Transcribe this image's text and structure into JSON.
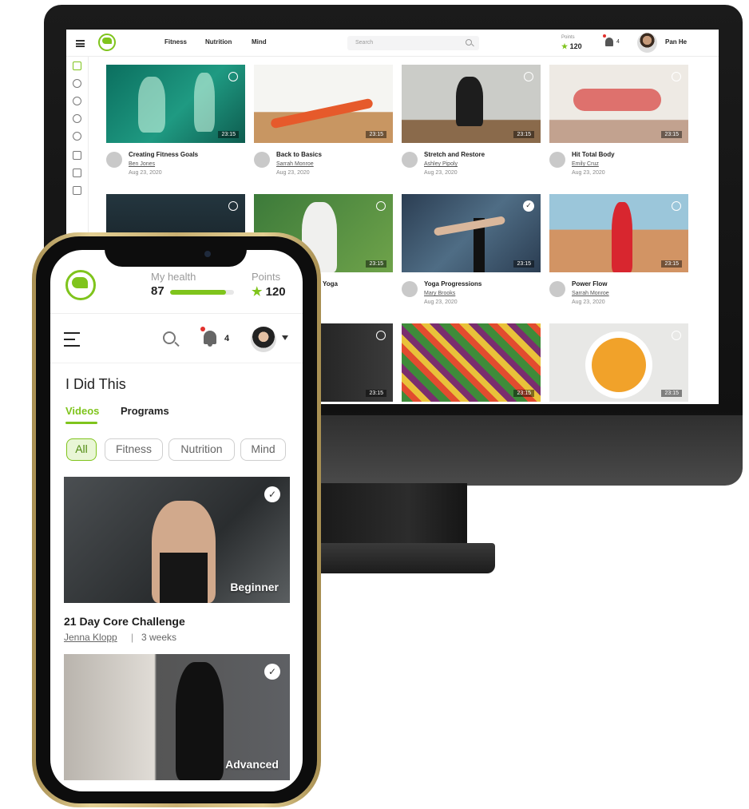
{
  "colors": {
    "accent": "#7fc41c",
    "notification": "#e2312d"
  },
  "desktop": {
    "nav": {
      "fitness": "Fitness",
      "nutrition": "Nutrition",
      "mind": "Mind"
    },
    "search": {
      "placeholder": "Search"
    },
    "points": {
      "label": "Points",
      "value": "120"
    },
    "notifications": {
      "count": "4"
    },
    "user": {
      "name": "Pan He"
    },
    "sidebar_icons": [
      "home-icon",
      "heart-icon",
      "check-circle-icon",
      "eye-icon",
      "clock-icon",
      "chart-icon",
      "megaphone-icon",
      "tv-icon"
    ],
    "videos": [
      {
        "title": "Creating Fitness Goals",
        "author": "Ben Jones",
        "date": "Aug 23, 2020",
        "duration": "23:15",
        "status": "clock"
      },
      {
        "title": "Back to Basics",
        "author": "Sarrah Monroe",
        "date": "Aug 23, 2020",
        "duration": "23:15",
        "status": "none"
      },
      {
        "title": "Stretch and Restore",
        "author": "Ashley Pipoly",
        "date": "Aug 23, 2020",
        "duration": "23:15",
        "status": "clock"
      },
      {
        "title": "Hit Total Body",
        "author": "Emily Cruz",
        "date": "Aug 23, 2020",
        "duration": "23:15",
        "status": "clock"
      },
      {
        "title": "",
        "author": "",
        "date": "",
        "duration": "",
        "status": "clock"
      },
      {
        "title": "Yoga",
        "author": "",
        "date": "",
        "duration": "23:15",
        "status": "clock"
      },
      {
        "title": "Yoga Progressions",
        "author": "Mary Brooks",
        "date": "Aug 23, 2020",
        "duration": "23:15",
        "status": "check"
      },
      {
        "title": "Power Flow",
        "author": "Sarrah Monroe",
        "date": "Aug 23, 2020",
        "duration": "23:15",
        "status": "clock"
      },
      {
        "title": "",
        "author": "",
        "date": "",
        "duration": "23:15",
        "status": "clock"
      },
      {
        "title": "",
        "author": "",
        "date": "",
        "duration": "23:15",
        "status": "none"
      },
      {
        "title": "",
        "author": "",
        "date": "",
        "duration": "23:15",
        "status": "clock"
      }
    ]
  },
  "mobile": {
    "health": {
      "label": "My health",
      "value": "87",
      "progress": 0.87
    },
    "points": {
      "label": "Points",
      "value": "120"
    },
    "notifications": {
      "count": "4"
    },
    "page_title": "I Did This",
    "tabs": [
      {
        "label": "Videos",
        "active": true
      },
      {
        "label": "Programs",
        "active": false
      }
    ],
    "filters": [
      {
        "label": "All",
        "active": true
      },
      {
        "label": "Fitness",
        "active": false
      },
      {
        "label": "Nutrition",
        "active": false
      },
      {
        "label": "Mind",
        "active": false
      }
    ],
    "programs": [
      {
        "title": "21 Day Core Challenge",
        "author": "Jenna Klopp",
        "separator": "|",
        "duration": "3 weeks",
        "level": "Beginner",
        "completed": true
      },
      {
        "level": "Advanced",
        "completed": true
      }
    ]
  }
}
